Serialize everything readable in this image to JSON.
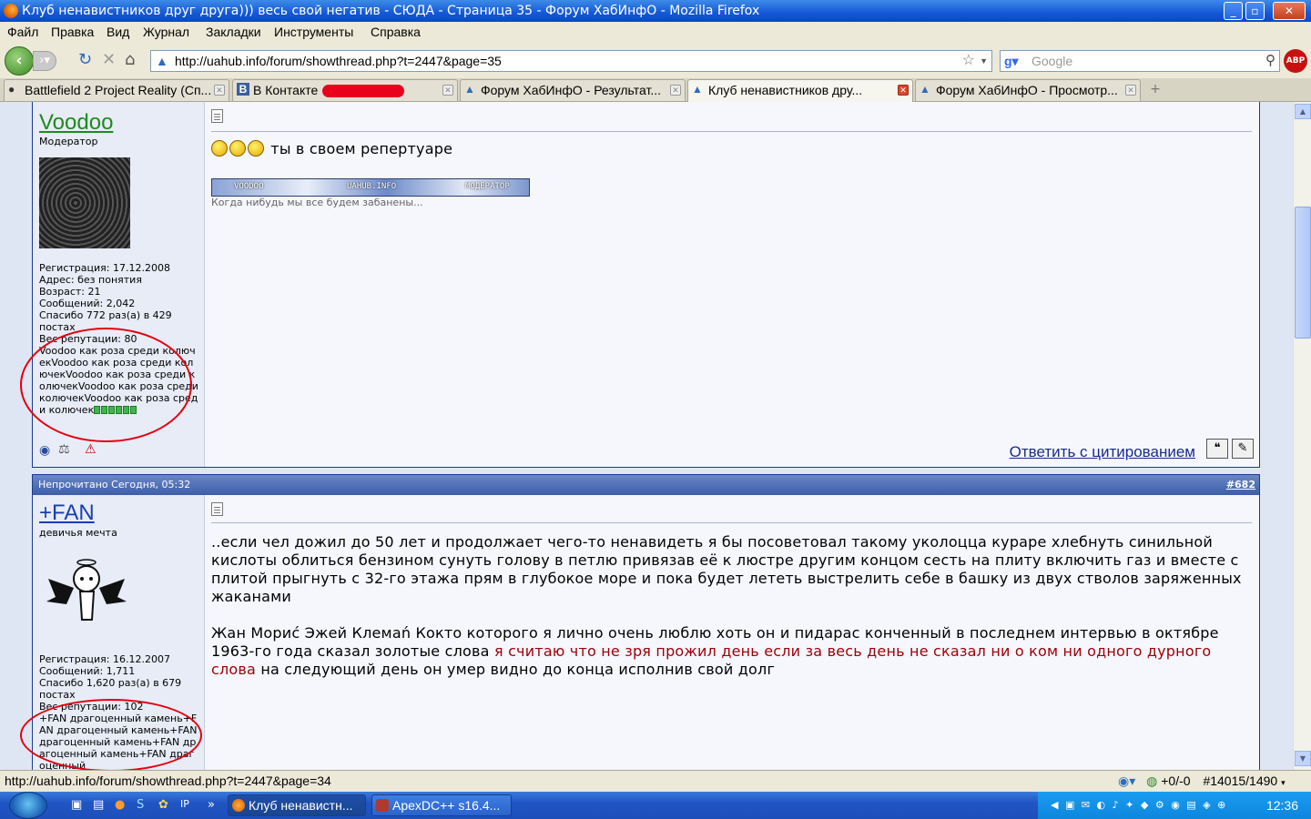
{
  "window": {
    "title": "Клуб ненавистников друг друга))) весь свой негатив - СЮДА - Страница 35 - Форум ХабИнфО - Mozilla Firefox"
  },
  "menu": [
    "Файл",
    "Правка",
    "Вид",
    "Журнал",
    "Закладки",
    "Инструменты",
    "Справка"
  ],
  "nav": {
    "url": "http://uahub.info/forum/showthread.php?t=2447&page=35",
    "search_placeholder": "Google",
    "abp_label": "ABP"
  },
  "tabs": [
    {
      "label": "Battlefield 2 Project Reality (Сп..."
    },
    {
      "label": "В Контакте"
    },
    {
      "label": "Форум ХабИнфО - Результат..."
    },
    {
      "label": "Клуб ненавистников дру..."
    },
    {
      "label": "Форум ХабИнфО - Просмотр..."
    }
  ],
  "posts": [
    {
      "username": "Voodoo",
      "user_title": "Модератор",
      "info": [
        "Регистрация: 17.12.2008",
        "Адрес: без понятия",
        "Возраст: 21",
        "Сообщений: 2,042",
        "Спасибо 772 раз(а) в 429 постах"
      ],
      "reputation_label": "Вес репутации: 80",
      "reputation_text": "Voodoo как роза среди колючекVoodoo как роза среди колючекVoodoo как роза среди колючекVoodoo как роза среди колючекVoodoo как роза среди колючек",
      "reputation_level": 6,
      "message": "ты в своем репертуаре",
      "sig_banner": [
        "VOODOO",
        "UAHUB.INFO",
        "МОДЕРАТОР"
      ],
      "signature": "Когда нибудь мы все будем забанены...",
      "reply_quote_label": "Ответить с цитированием"
    },
    {
      "header": "Непрочитано Сегодня, 05:32",
      "post_number": "#682",
      "username": "+FAN",
      "user_title": "девичья мечта",
      "info": [
        "Регистрация: 16.12.2007",
        "Сообщений: 1,711",
        "Спасибо 1,620 раз(а) в 679 постах"
      ],
      "reputation_label": "Вес репутации: 102",
      "reputation_text": "+FAN драгоценный камень+FAN драгоценный камень+FAN драгоценный камень+FAN драгоценный камень+FAN драгоценный",
      "paragraph1": "..если чел дожил до 50 лет и продолжает чего-то ненавидеть я бы посоветовал такому уколоцца кураре хлебнуть синильной кислоты облиться бензином сунуть голову в петлю привязав её к люстре другим концом сесть на плиту включить газ и вместе с плитой прыгнуть с 32-го этажа прям в глубокое море и пока будет лететь выстрелить себе в башку из двух стволов заряженных жаканами",
      "paragraph2_start": "Жан Мориć Эжей Клемаń Кокто которого я лично очень люблю хоть он и пидарас конченный в последнем интервью в октябре 1963-го года сказал золотые слова",
      "paragraph2_quote": "я считаю что не зря прожил день если за весь день не сказал ни о ком ни одного дурного слова",
      "paragraph2_end": "на следующий день он умер видно до конца исполнив свой долг"
    }
  ],
  "status": {
    "url": "http://uahub.info/forum/showthread.php?t=2447&page=34",
    "counters": "+0/-0",
    "hub": "#14015/1490"
  },
  "taskbar": {
    "items": [
      {
        "label": "Клуб ненавистн..."
      },
      {
        "label": "ApexDC++ s16.4..."
      }
    ],
    "ql_label": "IP",
    "clock": "12:36"
  }
}
